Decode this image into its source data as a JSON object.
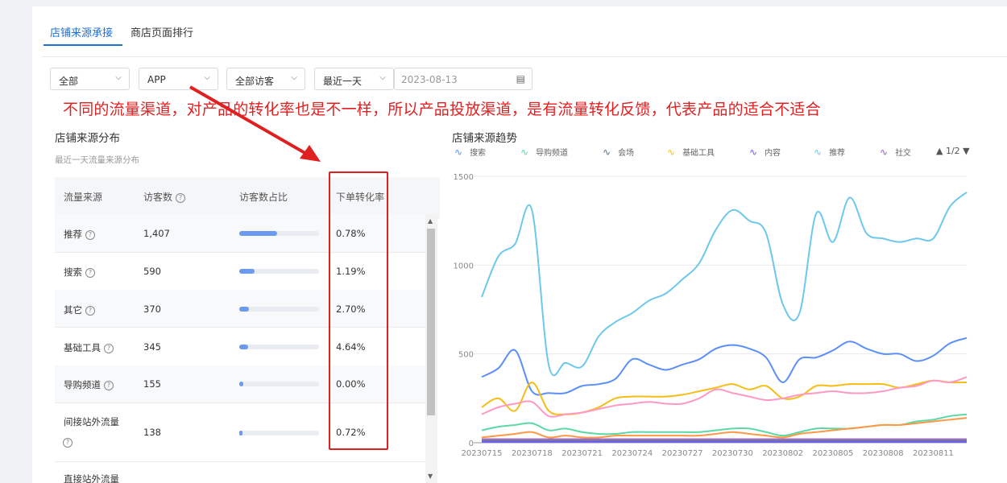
{
  "tabs": [
    {
      "label": "店铺来源承接",
      "active": true
    },
    {
      "label": "商店页面排行",
      "active": false
    }
  ],
  "filters": {
    "channel": "全部",
    "platform": "APP",
    "visitors": "全部访客",
    "period": "最近一天",
    "date": "2023-08-13"
  },
  "annotation": "不同的流量渠道，对产品的转化率也是不一样，所以产品投放渠道，是有流量转化反馈，代表产品的适合不适合",
  "distribution": {
    "title": "店铺来源分布",
    "subtitle": "最近一天流量来源分布",
    "columns": [
      "流量来源",
      "访客数",
      "访客数占比",
      "下单转化率"
    ],
    "rows": [
      {
        "source": "推荐",
        "visitors": "1,407",
        "share": 0.47,
        "rate": "0.78%"
      },
      {
        "source": "搜索",
        "visitors": "590",
        "share": 0.19,
        "rate": "1.19%"
      },
      {
        "source": "其它",
        "visitors": "370",
        "share": 0.12,
        "rate": "2.70%"
      },
      {
        "source": "基础工具",
        "visitors": "345",
        "share": 0.11,
        "rate": "4.64%"
      },
      {
        "source": "导购频道",
        "visitors": "155",
        "share": 0.05,
        "rate": "0.00%"
      },
      {
        "source": "间接站外流量",
        "visitors": "138",
        "share": 0.045,
        "rate": "0.72%"
      },
      {
        "source": "直接站外流量",
        "visitors": "",
        "share": 0,
        "rate": ""
      }
    ]
  },
  "trend": {
    "title": "店铺来源趋势",
    "pager": "▲ 1/2 ▼"
  },
  "chart_data": {
    "type": "line",
    "ylim": [
      0,
      1500
    ],
    "yticks": [
      0,
      500,
      1000,
      1500
    ],
    "x": [
      "20230715",
      "20230716",
      "20230717",
      "20230718",
      "20230719",
      "20230720",
      "20230721",
      "20230722",
      "20230723",
      "20230724",
      "20230725",
      "20230726",
      "20230727",
      "20230728",
      "20230729",
      "20230730",
      "20230731",
      "20230801",
      "20230802",
      "20230803",
      "20230804",
      "20230805",
      "20230806",
      "20230807",
      "20230808",
      "20230809",
      "20230810",
      "20230811",
      "20230812",
      "20230813"
    ],
    "xtick_labels": [
      "20230715",
      "20230718",
      "20230721",
      "20230724",
      "20230727",
      "20230730",
      "20230802",
      "20230805",
      "20230808",
      "20230811"
    ],
    "series": [
      {
        "name": "搜索",
        "color": "#5b8ff9",
        "values": [
          370,
          420,
          520,
          290,
          280,
          280,
          320,
          330,
          360,
          470,
          440,
          410,
          440,
          470,
          530,
          550,
          530,
          480,
          340,
          470,
          480,
          520,
          570,
          530,
          500,
          500,
          460,
          490,
          560,
          590
        ]
      },
      {
        "name": "导购频道",
        "color": "#5ad8a6",
        "values": [
          70,
          90,
          100,
          110,
          70,
          80,
          60,
          50,
          50,
          60,
          60,
          60,
          60,
          60,
          70,
          80,
          80,
          60,
          40,
          60,
          80,
          80,
          80,
          90,
          100,
          100,
          120,
          130,
          150,
          160
        ]
      },
      {
        "name": "会场",
        "color": "#5d7092",
        "values": [
          10,
          10,
          10,
          10,
          10,
          10,
          10,
          10,
          10,
          10,
          10,
          10,
          10,
          10,
          10,
          10,
          10,
          10,
          10,
          10,
          10,
          10,
          10,
          10,
          10,
          10,
          10,
          10,
          10,
          10
        ]
      },
      {
        "name": "基础工具",
        "color": "#f6bd16",
        "values": [
          200,
          250,
          180,
          340,
          180,
          160,
          170,
          200,
          250,
          260,
          260,
          260,
          270,
          290,
          310,
          330,
          300,
          320,
          250,
          260,
          320,
          320,
          330,
          330,
          330,
          310,
          330,
          350,
          340,
          340
        ]
      },
      {
        "name": "内容",
        "color": "#6f5ef9",
        "values": [
          5,
          5,
          5,
          5,
          5,
          5,
          5,
          5,
          5,
          5,
          5,
          5,
          5,
          5,
          5,
          5,
          5,
          5,
          5,
          5,
          5,
          5,
          5,
          5,
          5,
          5,
          5,
          5,
          5,
          5
        ]
      },
      {
        "name": "推荐",
        "color": "#6dc8ec",
        "values": [
          820,
          1050,
          1120,
          1310,
          440,
          450,
          430,
          600,
          680,
          730,
          800,
          840,
          920,
          1010,
          1200,
          1310,
          1250,
          1180,
          780,
          730,
          1290,
          1130,
          1380,
          1180,
          1150,
          1130,
          1150,
          1150,
          1330,
          1410
        ]
      },
      {
        "name": "社交",
        "color": "#945fb9",
        "values": [
          20,
          20,
          20,
          20,
          20,
          20,
          20,
          20,
          20,
          20,
          20,
          20,
          20,
          20,
          20,
          20,
          20,
          20,
          20,
          20,
          20,
          20,
          20,
          20,
          20,
          20,
          20,
          20,
          20,
          20
        ]
      },
      {
        "name": "",
        "color": "#ff99c3",
        "values": [
          160,
          200,
          220,
          230,
          150,
          160,
          170,
          190,
          210,
          220,
          230,
          220,
          220,
          250,
          300,
          280,
          260,
          240,
          250,
          270,
          280,
          290,
          280,
          280,
          290,
          310,
          320,
          350,
          340,
          370
        ]
      },
      {
        "name": "",
        "color": "#ff9845",
        "values": [
          30,
          40,
          50,
          60,
          30,
          40,
          30,
          30,
          40,
          40,
          40,
          40,
          40,
          40,
          50,
          60,
          50,
          40,
          30,
          50,
          60,
          70,
          80,
          90,
          100,
          100,
          110,
          120,
          130,
          140
        ]
      }
    ]
  }
}
